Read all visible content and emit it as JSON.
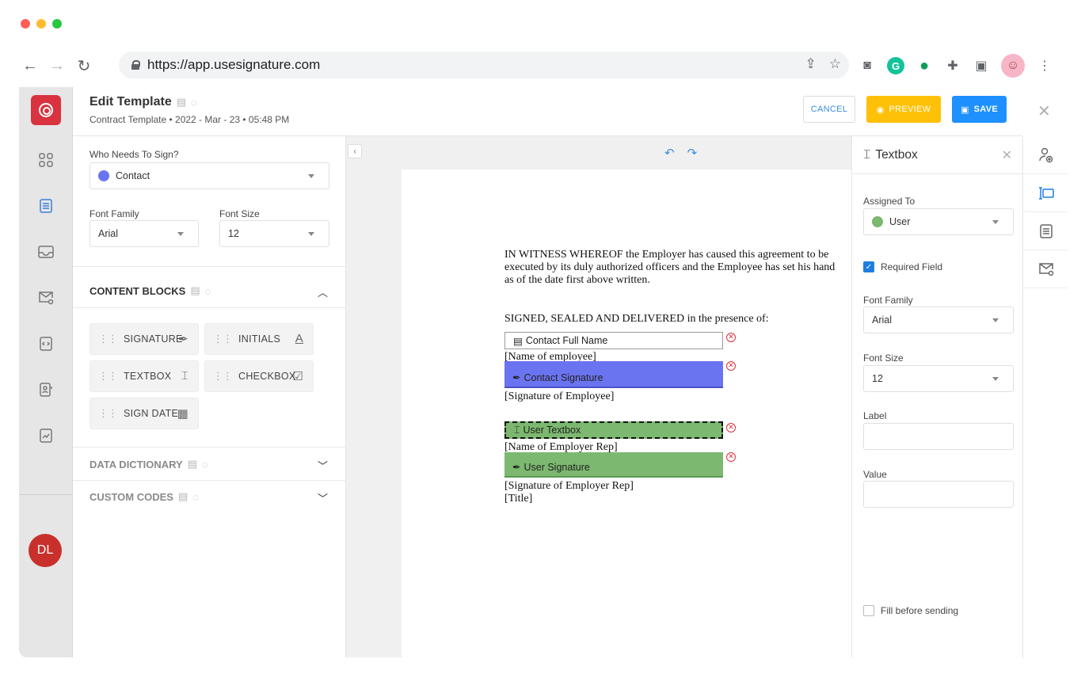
{
  "browser": {
    "url": "https://app.usesignature.com"
  },
  "header": {
    "title": "Edit Template",
    "subtitle": "Contract Template • 2022 - Mar - 23 • 05:48 PM",
    "cancel_label": "CANCEL",
    "preview_label": "PREVIEW",
    "save_label": "SAVE"
  },
  "user": {
    "initials": "DL"
  },
  "left_panel": {
    "signer_label": "Who Needs To Sign?",
    "signer_value": "Contact",
    "signer_color": "#6b74f0",
    "font_family_label": "Font Family",
    "font_family_value": "Arial",
    "font_size_label": "Font Size",
    "font_size_value": "12",
    "content_blocks_title": "CONTENT BLOCKS",
    "blocks": [
      {
        "label": "SIGNATURE",
        "icon": "pen-icon"
      },
      {
        "label": "INITIALS",
        "icon": "initials-icon"
      },
      {
        "label": "TEXTBOX",
        "icon": "textbox-icon"
      },
      {
        "label": "CHECKBOX",
        "icon": "checkbox-icon"
      },
      {
        "label": "SIGN DATE",
        "icon": "calendar-icon"
      }
    ],
    "data_dictionary_title": "DATA DICTIONARY",
    "custom_codes_title": "CUSTOM CODES"
  },
  "document": {
    "paragraph": "IN WITNESS WHEREOF the Employer has caused this agreement to be executed by its duly authorized officers and the Employee has set his hand as of the date first above written.",
    "paragraph_lines": [
      "IN WITNESS WHEREOF the Employer has caused this agreement to be",
      "executed by its duly authorized officers and the Employee has set his hand",
      "as of the date first above written."
    ],
    "signed_line": "SIGNED, SEALED AND DELIVERED in the presence of:",
    "field_contact_name": "Contact Full Name",
    "name_of_employee": "[Name of employee]",
    "field_contact_signature": "Contact Signature",
    "signature_of_employee": "[Signature of Employee]",
    "field_user_textbox": "User Textbox",
    "name_of_employer_rep": "[Name of Employer Rep]",
    "field_user_signature": "User Signature",
    "signature_of_employer_rep": "[Signature of Employer Rep]",
    "title_line": "[Title]"
  },
  "props_panel": {
    "title": "Textbox",
    "assigned_to_label": "Assigned To",
    "assigned_to_value": "User",
    "assigned_color": "#7cb86f",
    "required_label": "Required Field",
    "required_checked": true,
    "font_family_label": "Font Family",
    "font_family_value": "Arial",
    "font_size_label": "Font Size",
    "font_size_value": "12",
    "label_label": "Label",
    "label_value": "",
    "value_label": "Value",
    "value_value": "",
    "fill_before_label": "Fill before sending",
    "fill_before_checked": false
  },
  "colors": {
    "brand": "#d9333f",
    "accent": "#1e90ff",
    "preview": "#ffc107",
    "contact": "#6b74f0",
    "user": "#7cb86f"
  }
}
